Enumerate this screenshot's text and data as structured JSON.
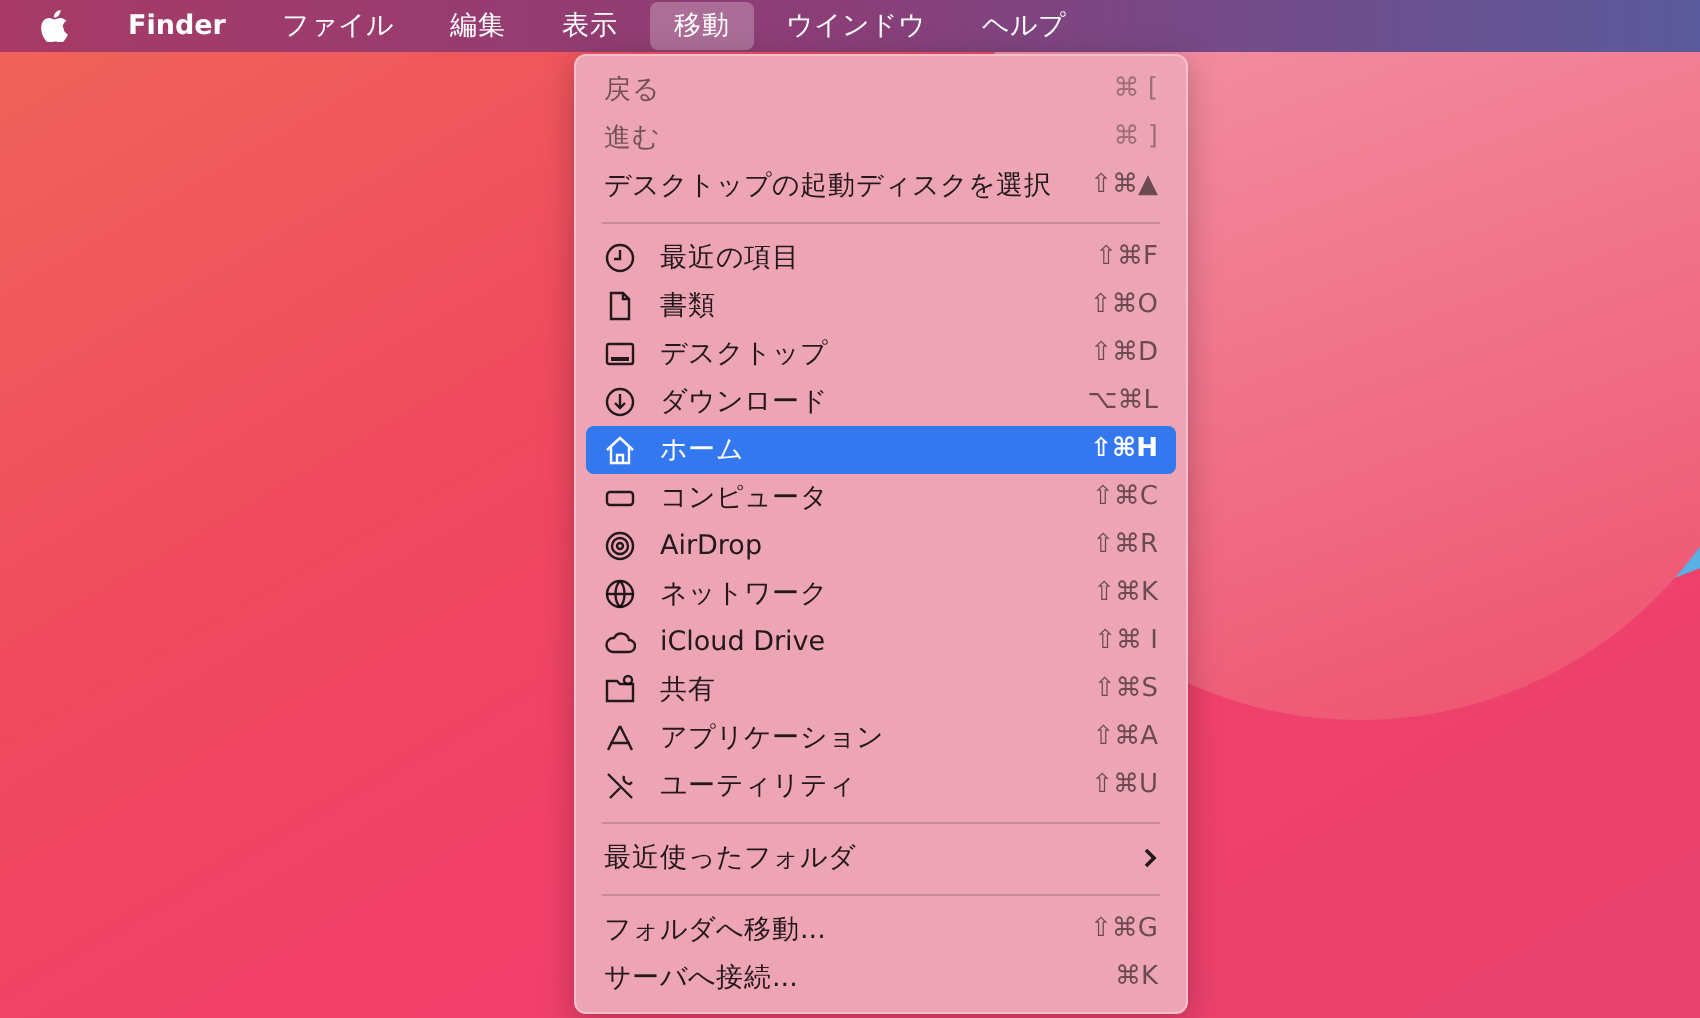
{
  "menu_bar": {
    "items": [
      {
        "label": "Finder",
        "kind": "app",
        "selected": false
      },
      {
        "label": "ファイル",
        "kind": "menu",
        "selected": false
      },
      {
        "label": "編集",
        "kind": "menu",
        "selected": false
      },
      {
        "label": "表示",
        "kind": "menu",
        "selected": false
      },
      {
        "label": "移動",
        "kind": "menu",
        "selected": true
      },
      {
        "label": "ウインドウ",
        "kind": "menu",
        "selected": false
      },
      {
        "label": "ヘルプ",
        "kind": "menu",
        "selected": false
      }
    ]
  },
  "menu": {
    "sections": [
      {
        "kind": "plain",
        "items": [
          {
            "label": "戻る",
            "shortcut": "⌘ [",
            "disabled": true,
            "selected": false
          },
          {
            "label": "進む",
            "shortcut": "⌘ ]",
            "disabled": true,
            "selected": false
          },
          {
            "label": "デスクトップの起動ディスクを選択",
            "shortcut": "⇧⌘▲",
            "disabled": false,
            "selected": false
          }
        ]
      },
      {
        "kind": "places",
        "items": [
          {
            "label": "最近の項目",
            "shortcut": "⇧⌘F",
            "disabled": false,
            "selected": false
          },
          {
            "label": "書類",
            "shortcut": "⇧⌘O",
            "disabled": false,
            "selected": false
          },
          {
            "label": "デスクトップ",
            "shortcut": "⇧⌘D",
            "disabled": false,
            "selected": false
          },
          {
            "label": "ダウンロード",
            "shortcut": "⌥⌘L",
            "disabled": false,
            "selected": false
          },
          {
            "label": "ホーム",
            "shortcut": "⇧⌘H",
            "disabled": false,
            "selected": true
          },
          {
            "label": "コンピュータ",
            "shortcut": "⇧⌘C",
            "disabled": false,
            "selected": false
          },
          {
            "label": "AirDrop",
            "shortcut": "⇧⌘R",
            "disabled": false,
            "selected": false
          },
          {
            "label": "ネットワーク",
            "shortcut": "⇧⌘K",
            "disabled": false,
            "selected": false
          },
          {
            "label": "iCloud Drive",
            "shortcut": "⇧⌘ I",
            "disabled": false,
            "selected": false
          },
          {
            "label": "共有",
            "shortcut": "⇧⌘S",
            "disabled": false,
            "selected": false
          },
          {
            "label": "アプリケーション",
            "shortcut": "⇧⌘A",
            "disabled": false,
            "selected": false
          },
          {
            "label": "ユーティリティ",
            "shortcut": "⇧⌘U",
            "disabled": false,
            "selected": false
          }
        ]
      },
      {
        "kind": "submenu",
        "items": [
          {
            "label": "最近使ったフォルダ",
            "disabled": false,
            "selected": false
          }
        ]
      },
      {
        "kind": "plain",
        "items": [
          {
            "label": "フォルダへ移動...",
            "shortcut": "⇧⌘G",
            "disabled": false,
            "selected": false
          },
          {
            "label": "サーバへ接続...",
            "shortcut": "⌘K",
            "disabled": false,
            "selected": false
          }
        ]
      }
    ]
  }
}
